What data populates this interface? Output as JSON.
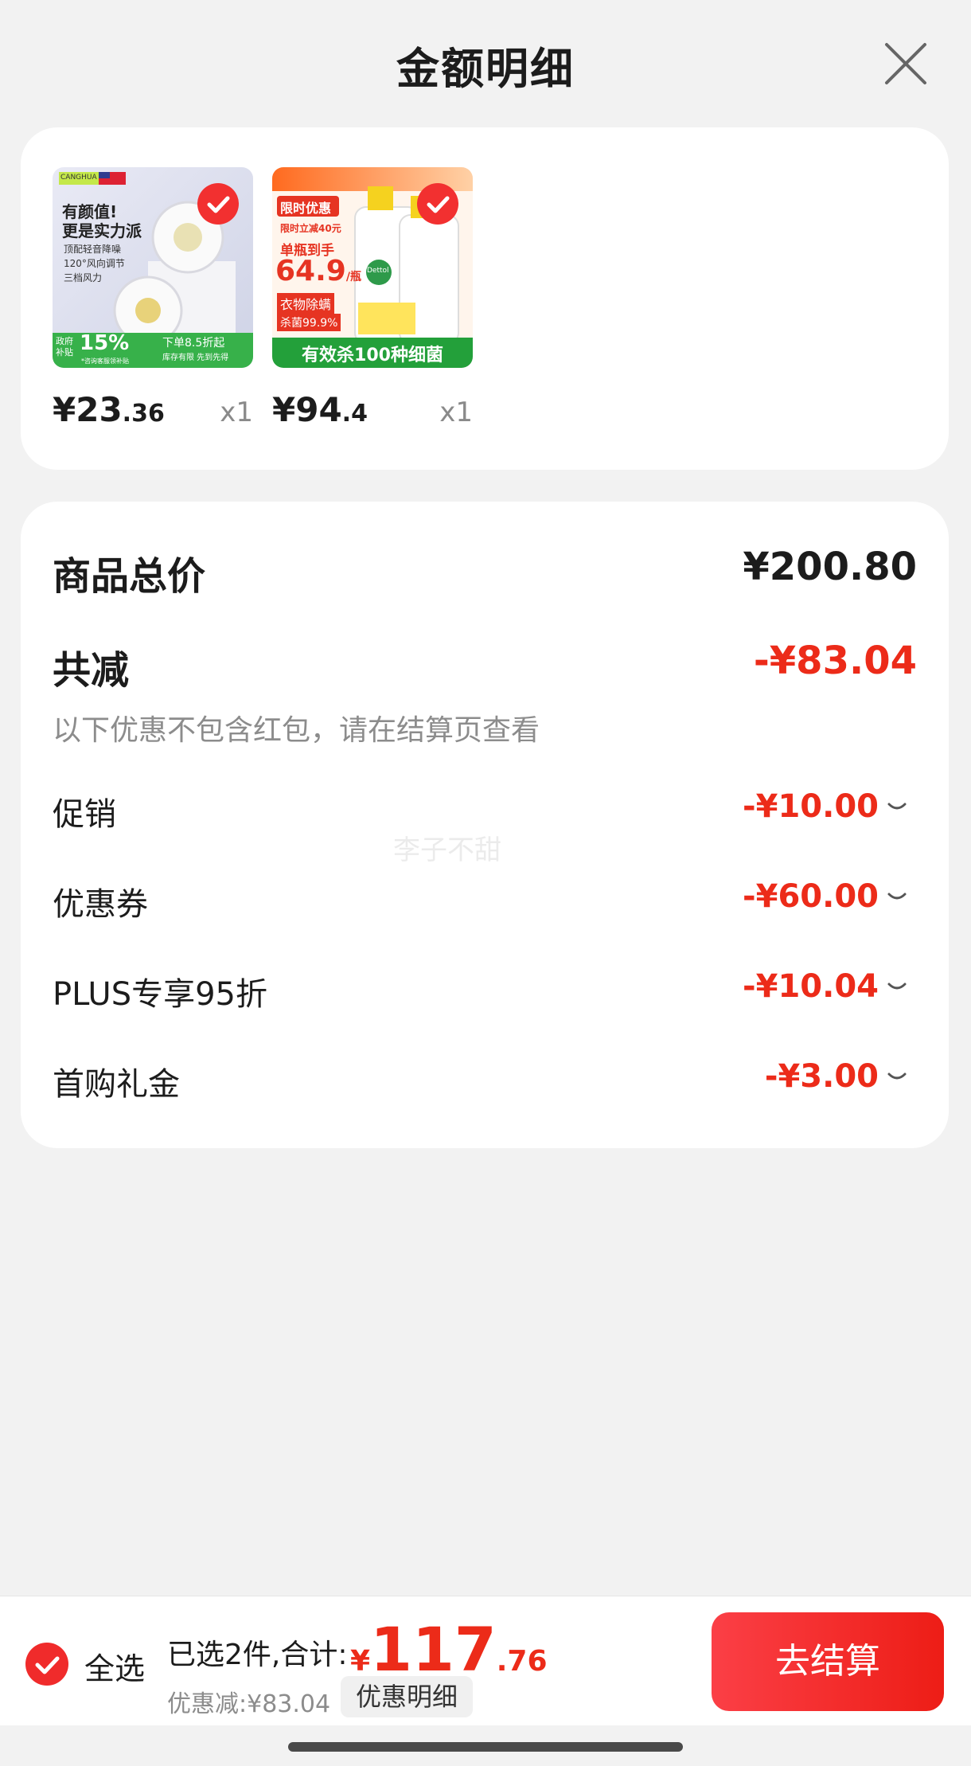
{
  "header": {
    "title": "金额明细",
    "close_icon": "close-icon"
  },
  "products": [
    {
      "price_int": "¥23",
      "price_dec": ".36",
      "qty": "x1",
      "image": {
        "brand": "CANGHUA",
        "headline1": "有颜值!",
        "headline2": "更是实力派",
        "features": [
          "顶配轻音降噪",
          "120°风向调节",
          "三档风力"
        ],
        "badge_left": "政府",
        "badge_left2": "补贴",
        "badge_pct": "15%",
        "badge_right": "下单8.5折起",
        "badge_right2": "库存有限 先到先得",
        "footnote": "*咨询客服领补贴"
      }
    },
    {
      "price_int": "¥94",
      "price_dec": ".4",
      "qty": "x1",
      "image": {
        "tag": "限时优惠",
        "promo": "限时立减40元",
        "line1": "单瓶到手",
        "price": "64.9",
        "unit": "/瓶",
        "line2": "衣物除螨",
        "line3": "杀菌99.9%",
        "banner": "有效杀100种细菌",
        "bottle_brand": "Dettol"
      }
    }
  ],
  "summary": {
    "total_label": "商品总价",
    "total_value": "¥200.80",
    "reduce_label": "共减",
    "reduce_value": "-¥83.04",
    "note": "以下优惠不包含红包，请在结算页查看",
    "discounts": [
      {
        "label": "促销",
        "value": "-¥10.00"
      },
      {
        "label": "优惠券",
        "value": "-¥60.00"
      },
      {
        "label": "PLUS专享95折",
        "value": "-¥10.04"
      },
      {
        "label": "首购礼金",
        "value": "-¥3.00"
      }
    ],
    "watermark": "李子不甜"
  },
  "bottom": {
    "select_all": "全选",
    "selected_text": "已选2件,合计:",
    "currency": "¥",
    "total_int": "117",
    "total_dec": ".76",
    "savings": "优惠减:¥83.04",
    "detail_button": "优惠明细",
    "checkout_button": "去结算"
  },
  "colors": {
    "accent": "#ec2b19",
    "check": "#f23030"
  }
}
